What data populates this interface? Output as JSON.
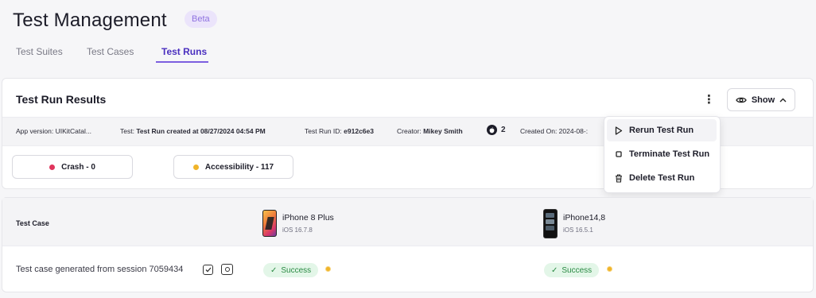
{
  "header": {
    "title": "Test Management",
    "badge": "Beta"
  },
  "tabs": [
    {
      "label": "Test Suites",
      "active": false
    },
    {
      "label": "Test Cases",
      "active": false
    },
    {
      "label": "Test Runs",
      "active": true
    }
  ],
  "results": {
    "title": "Test Run Results",
    "show_label": "Show",
    "meta": {
      "app_version": "App version: UIKitCatal...",
      "test_prefix": "Test:",
      "test_value": "Test Run created at 08/27/2024 04:54 PM",
      "run_id_prefix": "Test Run ID:",
      "run_id_value": "e912c6e3",
      "creator_prefix": "Creator:",
      "creator_value": "Mikey Smith",
      "apple_count": "2",
      "created_on": "Created On: 2024-08-:"
    },
    "filters": [
      {
        "label": "Crash - 0",
        "color": "#e0345c"
      },
      {
        "label": "Accessibility - 117",
        "color": "#f0b429"
      }
    ]
  },
  "menu": {
    "items": [
      {
        "label": "Rerun Test Run",
        "icon": "play-icon"
      },
      {
        "label": "Terminate Test Run",
        "icon": "stop-icon"
      },
      {
        "label": "Delete Test Run",
        "icon": "trash-icon"
      }
    ]
  },
  "table": {
    "header_label": "Test Case",
    "devices": [
      {
        "name": "iPhone 8 Plus",
        "os": "iOS 16.7.8"
      },
      {
        "name": "iPhone14,8",
        "os": "iOS 16.5.1"
      }
    ],
    "rows": [
      {
        "name": "Test case generated from session 7059434",
        "results": [
          "Success",
          "Success"
        ]
      }
    ]
  },
  "colors": {
    "accent": "#7c5fe0",
    "success_bg": "#e3f6e8",
    "success_text": "#2a8a43",
    "warning": "#f0b429"
  }
}
